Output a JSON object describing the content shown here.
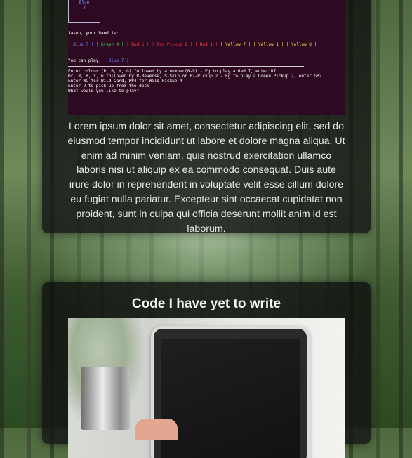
{
  "terminal": {
    "card_art": [
      "Blue",
      "2"
    ],
    "prompt_hand": "Jason, your hand is:",
    "hand": [
      {
        "text": "| Blue 7 |",
        "color": "#6c82ff"
      },
      {
        "text": "| Green 4 |",
        "color": "#3bd35a"
      },
      {
        "text": "| Red 6 |",
        "color": "#ff3b4a"
      },
      {
        "text": "| Red Pickup 2 |",
        "color": "#ff3b4a"
      },
      {
        "text": "| Red 1 |",
        "color": "#ff3b4a"
      },
      {
        "text": "| Yellow 7 |",
        "color": "#ffe24a"
      },
      {
        "text": "| Yellow 1 |",
        "color": "#ffe24a"
      },
      {
        "text": "| Yellow 8 |",
        "color": "#ffe24a"
      }
    ],
    "can_play_label": "You can play:",
    "can_play_card": "|  Blue 7  |",
    "instructions": [
      "Enter colour (R, B, Y, G) followed by a number(0-9) - Eg to play a Red 7, enter R7",
      "Or, R, B, Y, G followed by R-Reverse, S-Skip or P2-Pickup 2 - Eg to play a Green Pickup 2, enter GP2",
      "Enter WC for Wild Card, WP4 for Wild Pickup 4",
      "Enter D to pick up from the deck",
      "What would you like to play?"
    ]
  },
  "card1": {
    "body": "Lorem ipsum dolor sit amet, consectetur adipiscing elit, sed do eiusmod tempor incididunt ut labore et dolore magna aliqua. Ut enim ad minim veniam, quis nostrud exercitation ullamco laboris nisi ut aliquip ex ea commodo consequat. Duis aute irure dolor in reprehenderit in voluptate velit esse cillum dolore eu fugiat nulla pariatur. Excepteur sint occaecat cupidatat non proident, sunt in culpa qui officia deserunt mollit anim id est laborum."
  },
  "card2": {
    "title": "Code I have yet to write"
  },
  "colors": {
    "terminal_bg": "#2d0a22",
    "card_bg": "#141414"
  }
}
